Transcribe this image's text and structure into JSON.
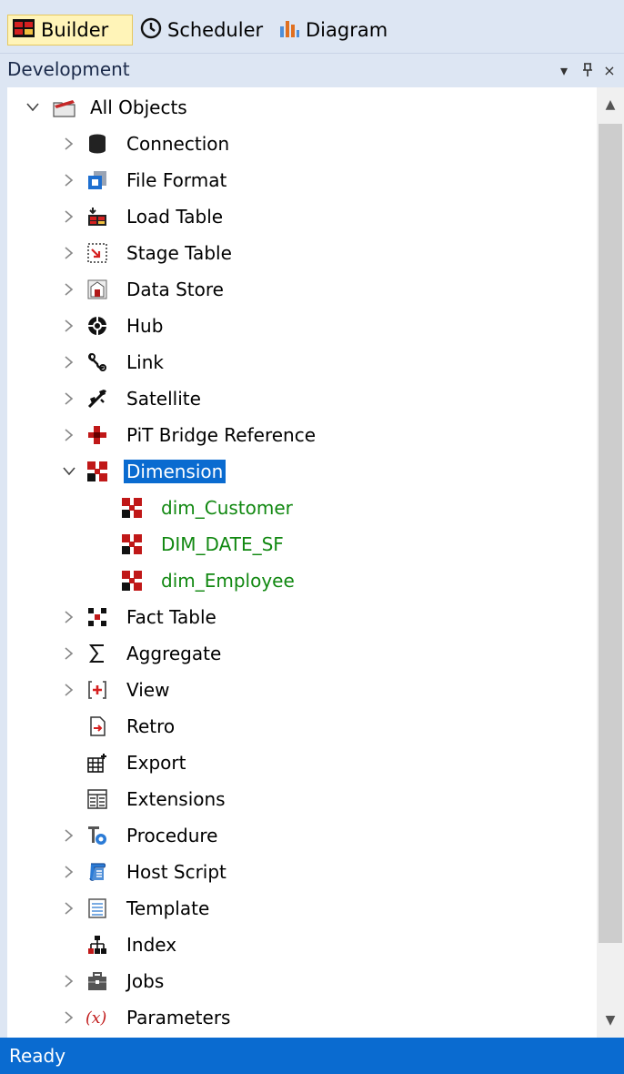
{
  "tabs": [
    {
      "label": "Builder",
      "icon": "builder-icon",
      "active": true
    },
    {
      "label": "Scheduler",
      "icon": "clock-icon",
      "active": false
    },
    {
      "label": "Diagram",
      "icon": "bar-chart-icon",
      "active": false
    }
  ],
  "panel": {
    "title": "Development",
    "controls": [
      "▾",
      "ᵖ",
      "×"
    ]
  },
  "tree": {
    "root": {
      "label": "All Objects",
      "icon": "folder-icon",
      "expanded": true
    },
    "items": [
      {
        "label": "Connection",
        "icon": "database-icon",
        "expandable": true
      },
      {
        "label": "File Format",
        "icon": "file-format-icon",
        "expandable": true
      },
      {
        "label": "Load Table",
        "icon": "load-table-icon",
        "expandable": true
      },
      {
        "label": "Stage Table",
        "icon": "stage-table-icon",
        "expandable": true
      },
      {
        "label": "Data Store",
        "icon": "data-store-icon",
        "expandable": true
      },
      {
        "label": "Hub",
        "icon": "hub-icon",
        "expandable": true
      },
      {
        "label": "Link",
        "icon": "link-icon",
        "expandable": true
      },
      {
        "label": "Satellite",
        "icon": "satellite-icon",
        "expandable": true
      },
      {
        "label": "PiT Bridge Reference",
        "icon": "pit-bridge-icon",
        "expandable": true
      },
      {
        "label": "Dimension",
        "icon": "dimension-icon",
        "expandable": true,
        "expanded": true,
        "selected": true,
        "children": [
          {
            "label": "dim_Customer",
            "icon": "dimension-icon"
          },
          {
            "label": "DIM_DATE_SF",
            "icon": "dimension-icon"
          },
          {
            "label": "dim_Employee",
            "icon": "dimension-icon"
          }
        ]
      },
      {
        "label": "Fact Table",
        "icon": "fact-table-icon",
        "expandable": true
      },
      {
        "label": "Aggregate",
        "icon": "sigma-icon",
        "expandable": true
      },
      {
        "label": "View",
        "icon": "view-icon",
        "expandable": true
      },
      {
        "label": "Retro",
        "icon": "retro-icon",
        "expandable": false
      },
      {
        "label": "Export",
        "icon": "export-icon",
        "expandable": false
      },
      {
        "label": "Extensions",
        "icon": "extensions-icon",
        "expandable": false
      },
      {
        "label": "Procedure",
        "icon": "procedure-icon",
        "expandable": true
      },
      {
        "label": "Host Script",
        "icon": "host-script-icon",
        "expandable": true
      },
      {
        "label": "Template",
        "icon": "template-icon",
        "expandable": true
      },
      {
        "label": "Index",
        "icon": "index-icon",
        "expandable": false
      },
      {
        "label": "Jobs",
        "icon": "jobs-icon",
        "expandable": true
      },
      {
        "label": "Parameters",
        "icon": "parameters-icon",
        "expandable": true
      }
    ]
  },
  "status": {
    "text": "Ready"
  },
  "colors": {
    "selection": "#0a6bd0",
    "child_text": "#118811",
    "panel_bg": "#dde6f3",
    "status_bg": "#0a6bd0"
  }
}
